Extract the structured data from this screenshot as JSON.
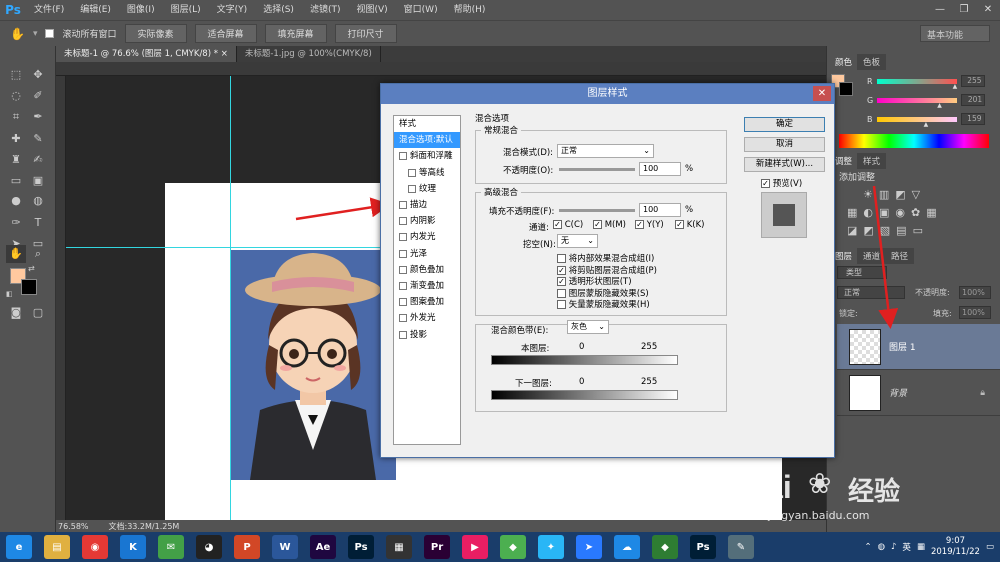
{
  "app": {
    "logo": "Ps",
    "menu": [
      "文件(F)",
      "编辑(E)",
      "图像(I)",
      "图层(L)",
      "文字(Y)",
      "选择(S)",
      "滤镜(T)",
      "视图(V)",
      "窗口(W)",
      "帮助(H)"
    ],
    "window_controls": [
      "—",
      "❐",
      "✕"
    ]
  },
  "options_bar": {
    "scroll_all_label": "滚动所有窗口",
    "buttons": [
      "实际像素",
      "适合屏幕",
      "填充屏幕",
      "打印尺寸"
    ],
    "workspace": "基本功能"
  },
  "doc_tabs": [
    "未标题-1 @ 76.6% (图层 1, CMYK/8) * ×",
    "未标题-1.jpg @ 100%(CMYK/8)"
  ],
  "status": {
    "zoom": "76.58%",
    "doc_info": "文档:33.2M/1.25M"
  },
  "panels": {
    "color_tabs": [
      "颜色",
      "色板"
    ],
    "sliders": [
      {
        "label": "R",
        "value": "255",
        "color_from": "#00ffcc",
        "color_to": "#ff5050",
        "level": 1.0
      },
      {
        "label": "G",
        "value": "201",
        "color_from": "#ff00c8",
        "color_to": "#ffcc80",
        "level": 0.79
      },
      {
        "label": "B",
        "value": "159",
        "color_from": "#ffc800",
        "color_to": "#ffc8ff",
        "level": 0.62
      }
    ],
    "adjust_tabs": [
      "调整",
      "样式"
    ],
    "adjust_add_label": "添加调整",
    "layer_tabs": [
      "图层",
      "通道",
      "路径"
    ],
    "kind_label": "类型",
    "blend_mode": "正常",
    "opacity_label": "不透明度:",
    "opacity_value": "100%",
    "lock_label": "锁定:",
    "fill_label": "填充:",
    "fill_value": "100%",
    "layers": [
      {
        "name": "图层 1",
        "selected": true
      },
      {
        "name": "背景",
        "selected": false
      }
    ]
  },
  "dialog": {
    "title": "图层样式",
    "style_list": [
      {
        "label": "样式",
        "checkbox": false,
        "selected": false,
        "indent": false
      },
      {
        "label": "混合选项:默认",
        "checkbox": false,
        "selected": true,
        "indent": false
      },
      {
        "label": "斜面和浮雕",
        "checkbox": true,
        "selected": false,
        "indent": false
      },
      {
        "label": "等高线",
        "checkbox": true,
        "selected": false,
        "indent": true
      },
      {
        "label": "纹理",
        "checkbox": true,
        "selected": false,
        "indent": true
      },
      {
        "label": "描边",
        "checkbox": true,
        "selected": false,
        "indent": false
      },
      {
        "label": "内阴影",
        "checkbox": true,
        "selected": false,
        "indent": false
      },
      {
        "label": "内发光",
        "checkbox": true,
        "selected": false,
        "indent": false
      },
      {
        "label": "光泽",
        "checkbox": true,
        "selected": false,
        "indent": false
      },
      {
        "label": "颜色叠加",
        "checkbox": true,
        "selected": false,
        "indent": false
      },
      {
        "label": "渐变叠加",
        "checkbox": true,
        "selected": false,
        "indent": false
      },
      {
        "label": "图案叠加",
        "checkbox": true,
        "selected": false,
        "indent": false
      },
      {
        "label": "外发光",
        "checkbox": true,
        "selected": false,
        "indent": false
      },
      {
        "label": "投影",
        "checkbox": true,
        "selected": false,
        "indent": false
      }
    ],
    "blend_options_title": "混合选项",
    "general_title": "常规混合",
    "blend_mode_label": "混合模式(D):",
    "blend_mode_value": "正常",
    "opacity_label": "不透明度(O):",
    "opacity_value": "100",
    "percent": "%",
    "advanced_title": "高级混合",
    "fill_opacity_label": "填充不透明度(F):",
    "fill_opacity_value": "100",
    "channels_label": "通道:",
    "channels": [
      "C(C)",
      "M(M)",
      "Y(Y)",
      "K(K)"
    ],
    "knockout_label": "挖空(N):",
    "knockout_value": "无",
    "options": [
      {
        "label": "将内部效果混合成组(I)",
        "checked": false
      },
      {
        "label": "将剪贴图层混合成组(P)",
        "checked": true
      },
      {
        "label": "透明形状图层(T)",
        "checked": true
      },
      {
        "label": "图层蒙版隐藏效果(S)",
        "checked": false
      },
      {
        "label": "矢量蒙版隐藏效果(H)",
        "checked": false
      }
    ],
    "blend_if_label": "混合颜色带(E):",
    "blend_if_value": "灰色",
    "this_layer_label": "本图层:",
    "underlying_label": "下一图层:",
    "range_min": "0",
    "range_max": "255",
    "buttons": [
      "确定",
      "取消",
      "新建样式(W)..."
    ],
    "preview_label": "预览(V)"
  },
  "taskbar": {
    "apps": [
      {
        "name": "edge",
        "glyph": "e",
        "color": "#1e88e5"
      },
      {
        "name": "explorer",
        "glyph": "▤",
        "color": "#e0b040"
      },
      {
        "name": "netease",
        "glyph": "◉",
        "color": "#e53935"
      },
      {
        "name": "k-app",
        "glyph": "K",
        "color": "#1976d2"
      },
      {
        "name": "wechat",
        "glyph": "✉",
        "color": "#43a047"
      },
      {
        "name": "qq",
        "glyph": "◕",
        "color": "#222"
      },
      {
        "name": "powerpoint",
        "glyph": "P",
        "color": "#d24726"
      },
      {
        "name": "word",
        "glyph": "W",
        "color": "#2b579a"
      },
      {
        "name": "after-effects",
        "glyph": "Ae",
        "color": "#1f0740"
      },
      {
        "name": "photoshop",
        "glyph": "Ps",
        "color": "#001e36"
      },
      {
        "name": "video",
        "glyph": "▦",
        "color": "#333"
      },
      {
        "name": "premiere",
        "glyph": "Pr",
        "color": "#2a0034"
      },
      {
        "name": "video-editor",
        "glyph": "▶",
        "color": "#e91e63"
      },
      {
        "name": "maps",
        "glyph": "◆",
        "color": "#4caf50"
      },
      {
        "name": "bird-app",
        "glyph": "✦",
        "color": "#29b6f6"
      },
      {
        "name": "feishu",
        "glyph": "➤",
        "color": "#2979ff"
      },
      {
        "name": "baidu-netdisk",
        "glyph": "☁",
        "color": "#1e88e5"
      },
      {
        "name": "green-app",
        "glyph": "◆",
        "color": "#2e7d32"
      },
      {
        "name": "photoshop-active",
        "glyph": "Ps",
        "color": "#001e36"
      },
      {
        "name": "pen-app",
        "glyph": "✎",
        "color": "#546e7a"
      }
    ],
    "lang": "英",
    "time": "9:07",
    "date": "2019/11/22"
  },
  "watermark": {
    "brand": "Bai",
    "brand2": "经验",
    "url": "jingyan.baidu.com"
  }
}
